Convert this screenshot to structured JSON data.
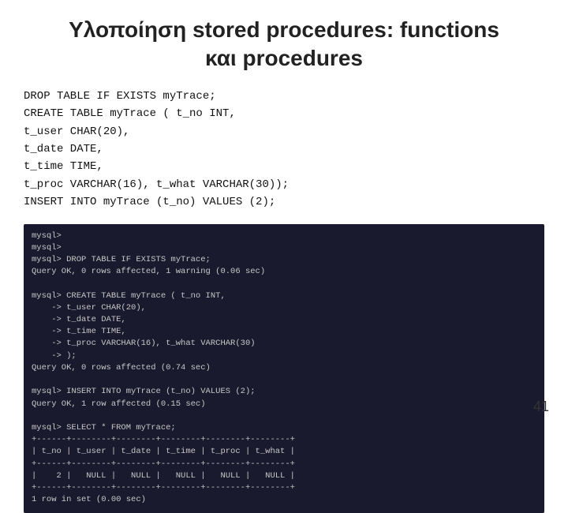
{
  "title_line1": "Υλοποίηση stored procedures: functions",
  "title_line2": "και procedures",
  "code_lines": [
    "DROP TABLE IF EXISTS myTrace;",
    "CREATE TABLE myTrace ( t_no INT,",
    "t_user CHAR(20),",
    "t_date DATE,",
    "t_time TIME,",
    "t_proc VARCHAR(16), t_what VARCHAR(30));",
    "INSERT INTO myTrace (t_no) VALUES (2);"
  ],
  "code_labels": [
    "DROP",
    "CREATE",
    "t_user",
    "t_date",
    "t_time",
    "t_proc",
    "INSERT"
  ],
  "terminal_content": "mysql>\nmysql>\nmysql> DROP TABLE IF EXISTS myTrace;\nQuery OK, 0 rows affected, 1 warning (0.06 sec)\n\nmysql> CREATE TABLE myTrace ( t_no INT,\n    -> t_user CHAR(20),\n    -> t_date DATE,\n    -> t_time TIME,\n    -> t_proc VARCHAR(16), t_what VARCHAR(30)\n    -> );\nQuery OK, 0 rows affected (0.74 sec)\n\nmysql> INSERT INTO myTrace (t_no) VALUES (2);\nQuery OK, 1 row affected (0.15 sec)\n\nmysql> SELECT * FROM myTrace;\n+------+--------+--------+--------+--------+--------+\n| t_no | t_user | t_date | t_time | t_proc | t_what |\n+------+--------+--------+--------+--------+--------+\n|    2 |   NULL |   NULL |   NULL |   NULL |   NULL |\n+------+--------+--------+--------+--------+--------+\n1 row in set (0.00 sec)",
  "page_number": "41"
}
